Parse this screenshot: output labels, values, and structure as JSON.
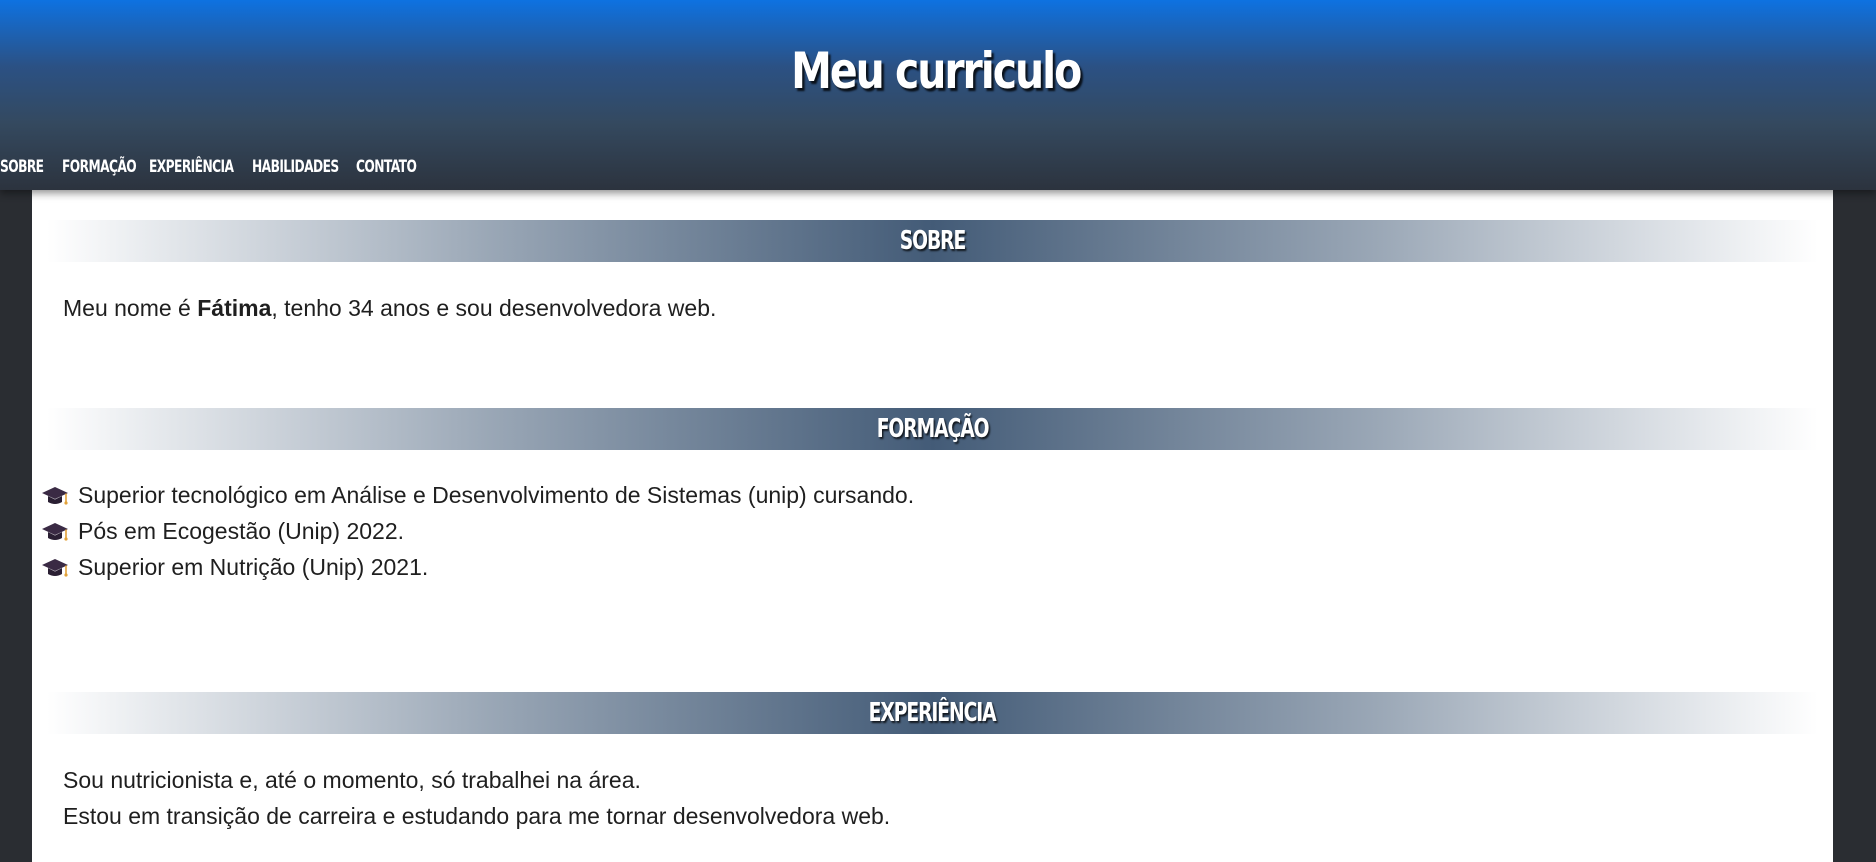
{
  "header": {
    "title": "Meu curriculo"
  },
  "nav": {
    "items": [
      {
        "label": "SOBRE"
      },
      {
        "label": "FORMAÇÃO"
      },
      {
        "label": "EXPERIÊNCIA"
      },
      {
        "label": "HABILIDADES"
      },
      {
        "label": "CONTATO"
      }
    ]
  },
  "sobre": {
    "heading": "SOBRE",
    "text_before": "Meu nome é ",
    "name": "Fátima",
    "text_after": ", tenho 34 anos e sou desenvolvedora web."
  },
  "formacao": {
    "heading": "FORMAÇÃO",
    "items": [
      {
        "icon": "graduation-cap-icon",
        "text": "Superior tecnológico em Análise e Desenvolvimento de Sistemas (unip) cursando."
      },
      {
        "icon": "graduation-cap-icon",
        "text": "Pós em Ecogestão (Unip) 2022."
      },
      {
        "icon": "graduation-cap-icon",
        "text": "Superior em Nutrição (Unip) 2021."
      }
    ]
  },
  "experiencia": {
    "heading": "EXPERIÊNCIA",
    "lines": [
      "Sou nutricionista e, até o momento, só trabalhei na área.",
      "Estou em transição de carreira e estudando para me tornar desenvolvedora web."
    ]
  },
  "colors": {
    "header_top": "#0e72e1",
    "header_bottom": "#2c333e",
    "page_bg": "#2a2d32",
    "heading_band_center": "#435b77"
  }
}
